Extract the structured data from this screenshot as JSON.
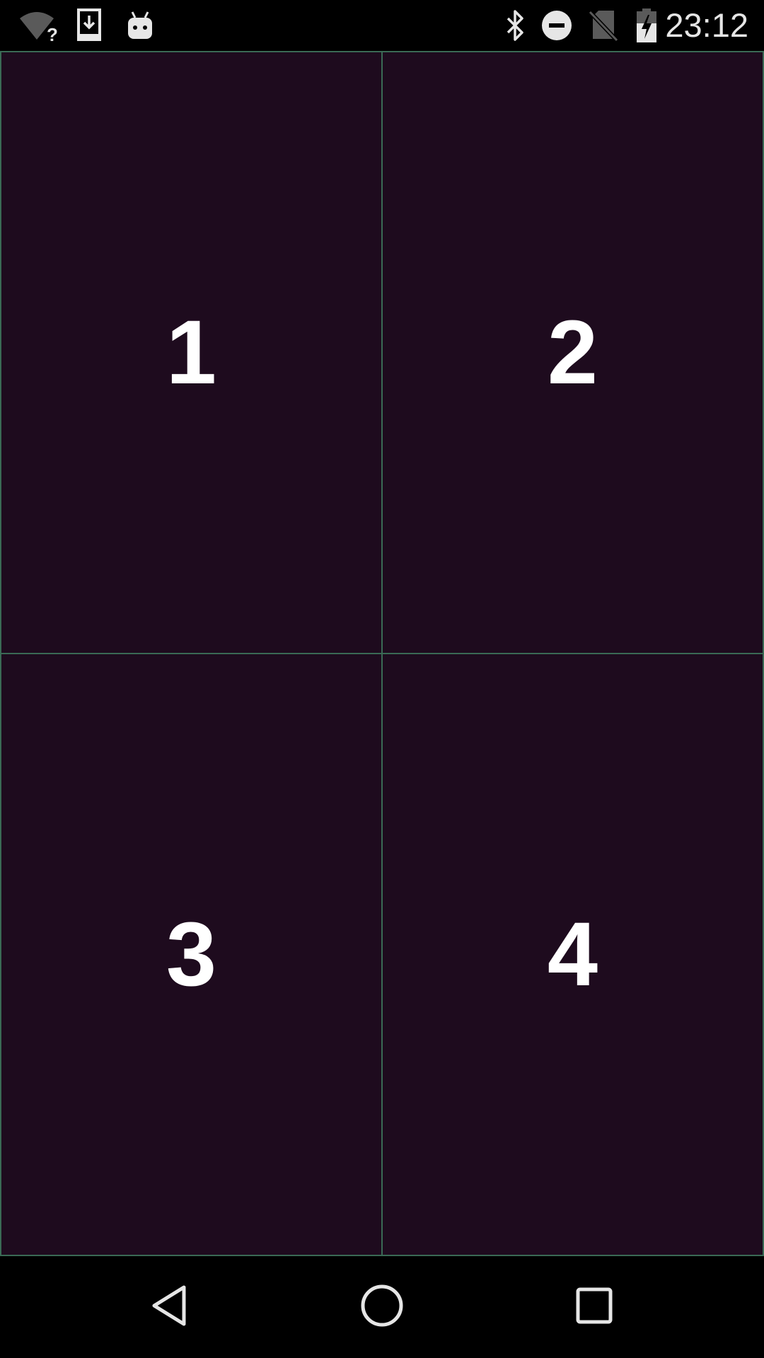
{
  "status_bar": {
    "time": "23:12",
    "left_icons": [
      "wifi-unknown-icon",
      "download-icon",
      "android-debug-icon"
    ],
    "right_icons": [
      "bluetooth-icon",
      "do-not-disturb-icon",
      "no-sim-icon",
      "battery-charging-icon"
    ]
  },
  "grid": {
    "cells": [
      {
        "label": "1"
      },
      {
        "label": "2"
      },
      {
        "label": "3"
      },
      {
        "label": "4"
      }
    ],
    "colors": {
      "cell_background": "#1e0b1e",
      "divider": "#3a6a55",
      "label": "#ffffff"
    }
  },
  "nav_bar": {
    "buttons": [
      "back-icon",
      "home-icon",
      "recents-icon"
    ]
  }
}
